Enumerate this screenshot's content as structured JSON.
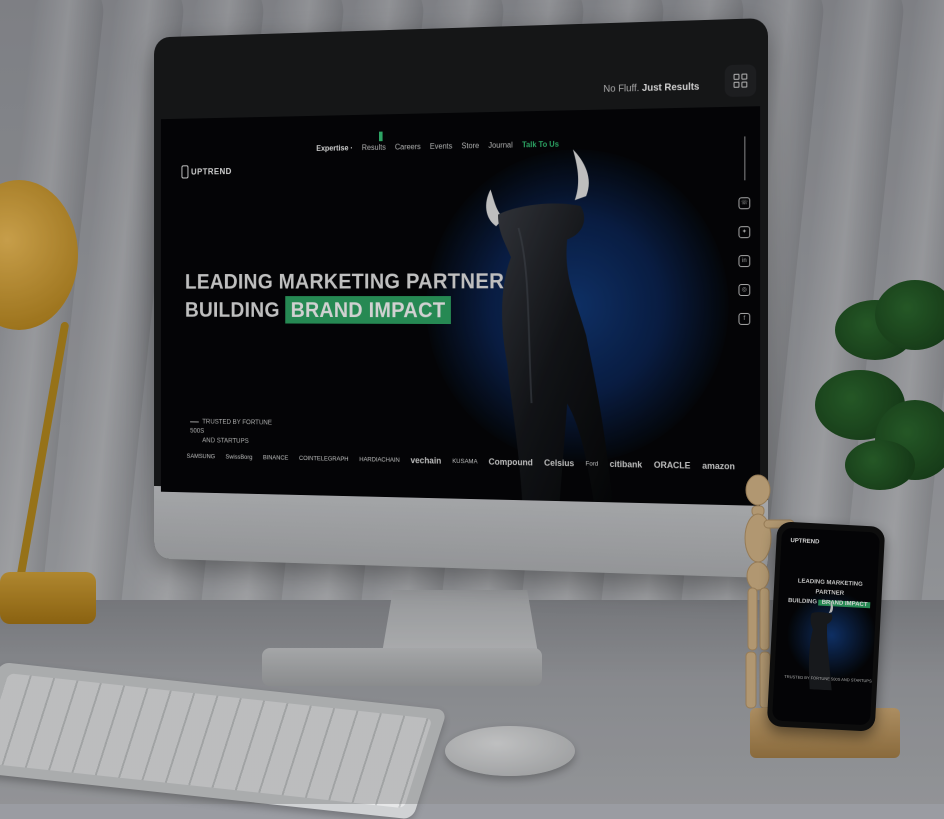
{
  "site": {
    "brand": "UPTREND",
    "tagline_light": "No Fluff.",
    "tagline_bold": "Just Results"
  },
  "nav": {
    "items": [
      {
        "label": "Expertise ·"
      },
      {
        "label": "Results"
      },
      {
        "label": "Careers"
      },
      {
        "label": "Events"
      },
      {
        "label": "Store"
      },
      {
        "label": "Journal"
      }
    ],
    "cta": "Talk To Us"
  },
  "hero": {
    "line1": "LEADING MARKETING PARTNER",
    "line2_prefix": "BUILDING",
    "line2_highlight": "BRAND IMPACT"
  },
  "trusted": {
    "line1": "TRUSTED BY FORTUNE 500S",
    "line2": "AND STARTUPS"
  },
  "brands": [
    "SAMSUNG",
    "SwissBorg",
    "BINANCE",
    "COINTELEGRAPH",
    "HARDIACHAIN",
    "vechain",
    "KUSAMA",
    "Compound",
    "Celsius",
    "Ford",
    "citibank",
    "ORACLE",
    "amazon"
  ],
  "social": [
    "whatsapp-icon",
    "twitter-icon",
    "linkedin-icon",
    "instagram-icon",
    "facebook-icon"
  ],
  "phone": {
    "brand": "UPTREND",
    "title_line1": "LEADING MARKETING PARTNER",
    "title_prefix": "BUILDING",
    "title_highlight": "BRAND IMPACT",
    "trusted": "TRUSTED BY FORTUNE 500S AND STARTUPS"
  },
  "colors": {
    "accent": "#2fa866",
    "cta": "#37c87a",
    "screen_bg": "#050608",
    "glow": "#123a7a"
  }
}
